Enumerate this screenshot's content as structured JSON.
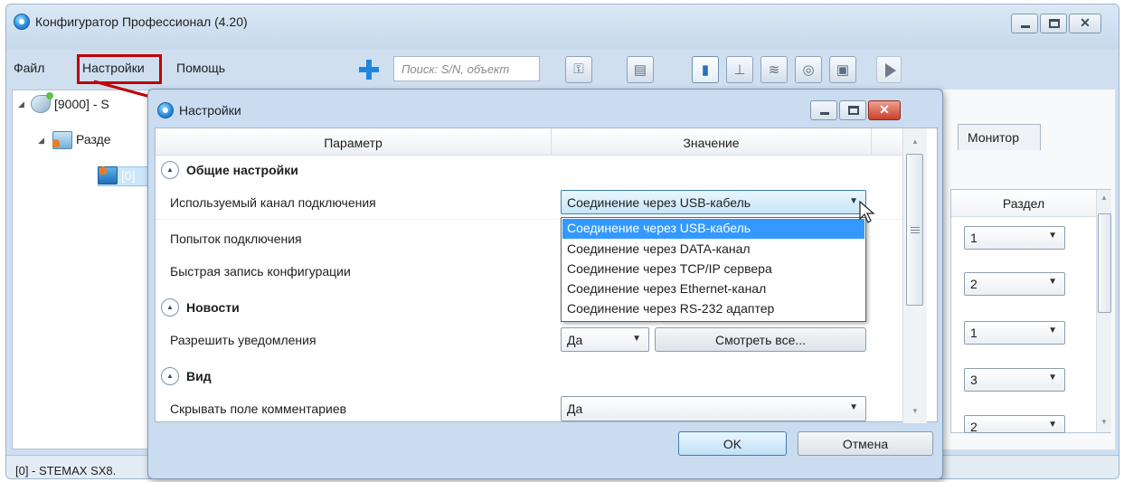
{
  "main_window": {
    "title": "Конфигуратор Профессионал (4.20)",
    "menu": [
      "Файл",
      "Настройки",
      "Помощь"
    ],
    "search_placeholder": "Поиск: S/N, объект"
  },
  "tree": {
    "root_label": "[9000] - S",
    "group_label": "Разде",
    "device_label": "[0]"
  },
  "status_bar": {
    "text": "[0] - STEMAX SX8."
  },
  "right_pane": {
    "tab_label": "Монитор",
    "column_header": "Раздел",
    "values": [
      "1",
      "2",
      "1",
      "3",
      "2"
    ]
  },
  "dialog": {
    "title": "Настройки",
    "col_param": "Параметр",
    "col_value": "Значение",
    "groups": {
      "general": "Общие настройки",
      "news": "Новости",
      "view": "Вид"
    },
    "params": {
      "channel": "Используемый канал подключения",
      "attempts": "Попыток подключения",
      "fast_write": "Быстрая запись конфигурации",
      "allow_notif": "Разрешить уведомления",
      "hide_comments": "Скрывать поле комментариев"
    },
    "values": {
      "channel": "Соединение через USB-кабель",
      "allow_notif": "Да",
      "hide_comments": "Да"
    },
    "view_all_button": "Смотреть все...",
    "dropdown_options": [
      "Соединение через USB-кабель",
      "Соединение через DATA-канал",
      "Соединение через TCP/IP сервера",
      "Соединение через Ethernet-канал",
      "Соединение через RS-232 адаптер"
    ],
    "ok_label": "OK",
    "cancel_label": "Отмена"
  },
  "colors": {
    "highlight_border": "#c00000",
    "selection": "#3399ff",
    "window_frame": "#c9dcf0"
  }
}
